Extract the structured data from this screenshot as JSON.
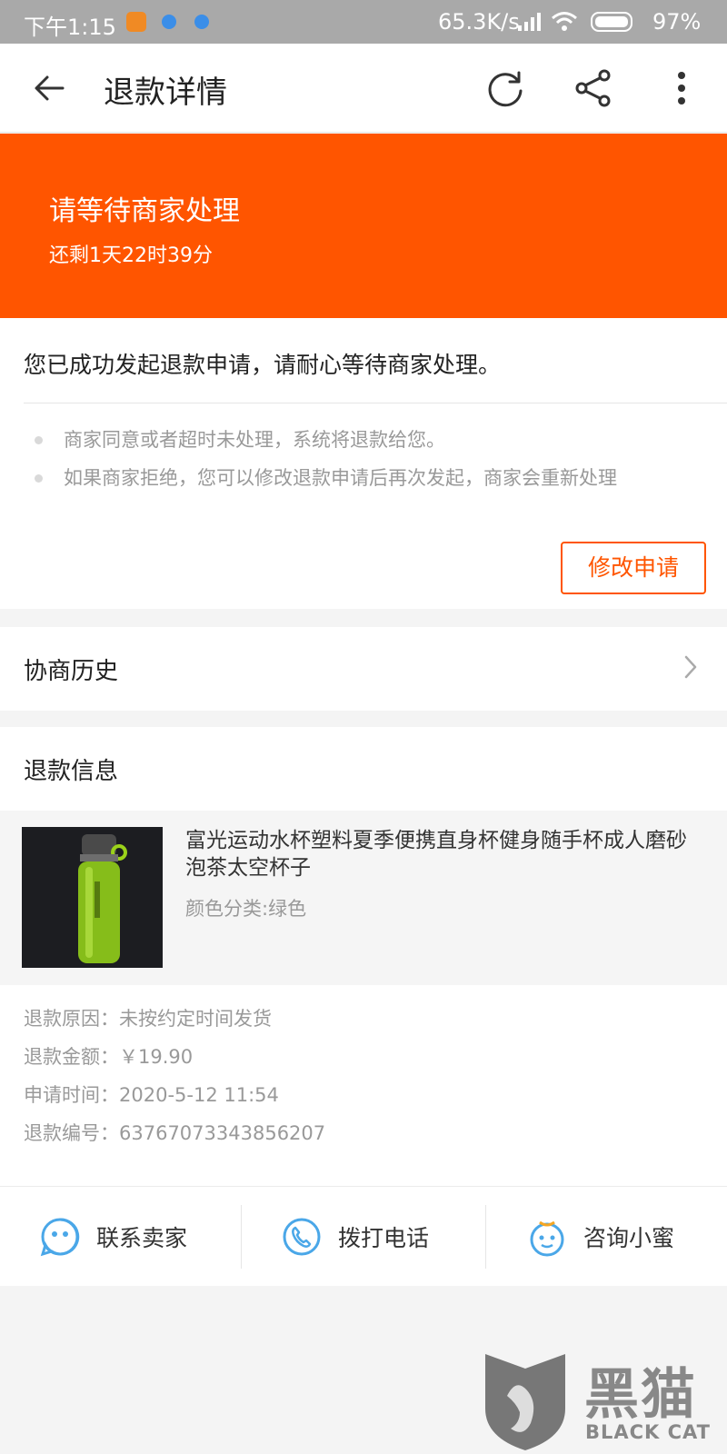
{
  "status_bar": {
    "time": "下午1:15",
    "network_speed": "65.3K/s",
    "battery": "97%"
  },
  "app_bar": {
    "title": "退款详情",
    "back_icon": "arrow-left-icon",
    "refresh_icon": "refresh-icon",
    "share_icon": "share-icon",
    "more_icon": "more-vertical-icon"
  },
  "banner": {
    "heading": "请等待商家处理",
    "countdown": "还剩1天22时39分",
    "color": "#ff5500"
  },
  "notice": {
    "message": "您已成功发起退款申请，请耐心等待商家处理。",
    "tips": [
      "商家同意或者超时未处理，系统将退款给您。",
      "如果商家拒绝，您可以修改退款申请后再次发起，商家会重新处理"
    ],
    "modify_button": "修改申请"
  },
  "history": {
    "label": "协商历史"
  },
  "refund_info": {
    "title": "退款信息",
    "product": {
      "name": "富光运动水杯塑料夏季便携直身杯健身随手杯成人磨砂泡茶太空杯子",
      "spec": "颜色分类:绿色"
    },
    "details": [
      "退款原因：未按约定时间发货",
      "退款金额：￥19.90",
      "申请时间：2020-5-12 11:54",
      "退款编号：63767073343856207"
    ]
  },
  "actions": [
    {
      "label": "联系卖家",
      "icon": "chat-smile-icon"
    },
    {
      "label": "拨打电话",
      "icon": "phone-icon"
    },
    {
      "label": "咨询小蜜",
      "icon": "assistant-face-icon"
    }
  ],
  "watermark": {
    "text": "黑猫",
    "sub": "BLACK CAT"
  }
}
